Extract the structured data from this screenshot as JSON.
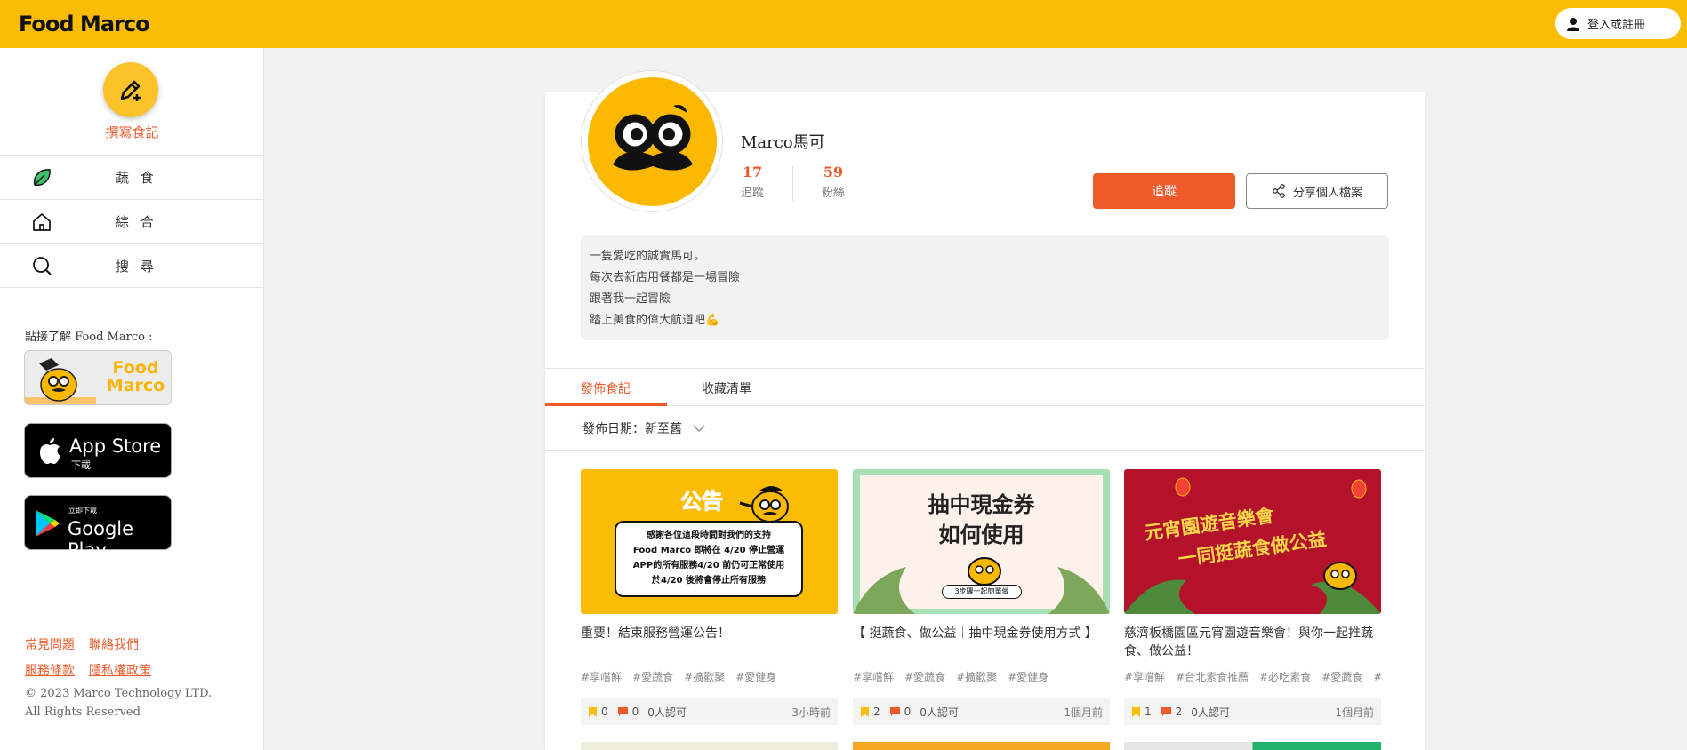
{
  "header": {
    "logo_text": "Food Marco",
    "login_label": "登入或註冊",
    "brand_color": "#fbbc05"
  },
  "sidebar": {
    "write_label": "撰寫食記",
    "nav_items": [
      {
        "label": "蔬 食",
        "icon": "leaf-icon"
      },
      {
        "label": "綜 合",
        "icon": "home-icon"
      },
      {
        "label": "搜 尋",
        "icon": "search-icon"
      }
    ],
    "learn_more": "點接了解 Food Marco :",
    "fm_badge_text": "Food Marco",
    "app_store": {
      "big": "App Store",
      "small": "下載"
    },
    "google_play": {
      "big": "Google Play",
      "small": "立即下載"
    },
    "links": [
      "常見問題",
      "聯絡我們",
      "服務條款",
      "隱私權政策"
    ],
    "copyright_line1": "© 2023 Marco Technology LTD.",
    "copyright_line2": "All Rights Reserved"
  },
  "profile": {
    "name": "Marco馬可",
    "following_count": "17",
    "following_label": "追蹤",
    "followers_count": "59",
    "followers_label": "粉絲",
    "follow_button": "追蹤",
    "share_button": "分享個人檔案",
    "bio_lines": [
      "一隻愛吃的誠實馬可。",
      "每次去新店用餐都是一場冒險",
      "跟著我一起冒險",
      "踏上美食的偉大航道吧💪"
    ]
  },
  "posts_section": {
    "tabs": [
      "發佈食記",
      "收藏清單"
    ],
    "sort_label": "發佈日期：新至舊",
    "posts": [
      {
        "thumb_heading": "公告",
        "thumb_lines": [
          "感謝各位這段時間對我們的支持",
          "Food Marco 即將在 4/20 停止營運",
          "APP的所有服務4/20 前仍可正常使用",
          "於4/20 後將會停止所有服務"
        ],
        "title": "重要！結束服務營運公告！",
        "tags": [
          "#享嚐鮮",
          "#愛蔬食",
          "#擴歡聚",
          "#愛健身"
        ],
        "saves": "0",
        "comments": "0",
        "likes": "0人認可",
        "time": "3小時前"
      },
      {
        "thumb_heading": "抽中現金券",
        "thumb_sub": "如何使用",
        "thumb_tag": "3步驟一起簡單做",
        "title": "【 挺蔬食、做公益｜抽中現金券使用方式 】",
        "tags": [
          "#享嚐鮮",
          "#愛蔬食",
          "#擴歡聚",
          "#愛健身"
        ],
        "saves": "2",
        "comments": "0",
        "likes": "0人認可",
        "time": "1個月前"
      },
      {
        "thumb_heading": "元宵園遊音樂會",
        "thumb_sub": "一同挺蔬食做公益",
        "title": "慈濟板橋園區元宵園遊音樂會！與你一起推蔬食、做公益！",
        "tags": [
          "#享嚐鮮",
          "#台北素食推薦",
          "#必吃素食",
          "#愛蔬食",
          "#…"
        ],
        "saves": "1",
        "comments": "2",
        "likes": "0人認可",
        "time": "1個月前"
      }
    ]
  },
  "colors": {
    "accent": "#ef5a2b",
    "yellow": "#fbbc05",
    "background": "#f2f2f2"
  }
}
